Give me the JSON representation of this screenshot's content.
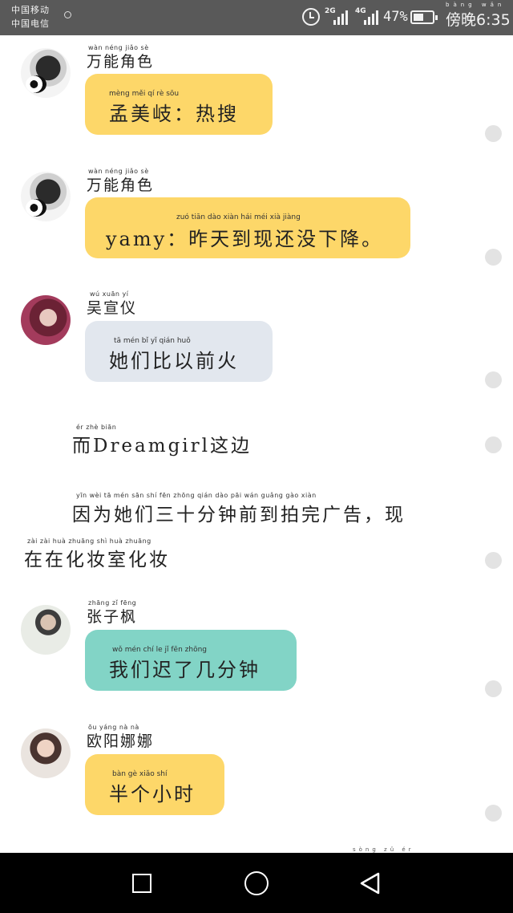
{
  "status_bar": {
    "carrier_1": "中国移动",
    "carrier_2": "中国电信",
    "net_1": "2G",
    "net_2": "4G",
    "battery_percent": "47%",
    "time": "傍晚6:35",
    "time_pinyin": "bàng wǎn"
  },
  "messages": [
    {
      "name_pinyin": "wàn néng jiǎo sè",
      "name": "万能角色",
      "text_pinyin": "mèng měi qí            rè  sōu",
      "text": "孟美岐：热搜"
    },
    {
      "name_pinyin": "wàn néng jiǎo sè",
      "name": "万能角色",
      "text_pinyin": "zuó  tiān  dào  xiàn  hái  méi  xià  jiàng",
      "text": "yamy：昨天到现还没下降。"
    },
    {
      "name_pinyin": "wú  xuān  yí",
      "name": "吴宣仪",
      "text_pinyin": "tā   mén  bǐ    yǐ   qián  huǒ",
      "text": "她们比以前火"
    },
    {
      "name_pinyin": "zhāng  zǐ  fēng",
      "name": "张子枫",
      "text_pinyin": "wǒ  mén  chí   le    jǐ   fēn zhōng",
      "text": "我们迟了几分钟"
    },
    {
      "name_pinyin": "ōu  yáng  nà   nà",
      "name": "欧阳娜娜",
      "text_pinyin": "bàn  gè  xiǎo  shí",
      "text": "半个小时"
    }
  ],
  "narration": {
    "line1_pinyin": "ér                              zhè  biān",
    "line1": "而Dreamgirl这边",
    "line2_pinyin": "yīn   wèi   tā   mén   sān   shí   fēn zhōng qián  dào   pāi  wán guǎng gào              xiàn",
    "line2": "因为她们三十分钟前到拍完广告，现",
    "line3_pinyin": "zài   zài   huà zhuāng shì   huà zhuāng",
    "line3": "在在化妆室化妆"
  },
  "bottom_peek_pinyin": "sòng  zǔ   ér"
}
